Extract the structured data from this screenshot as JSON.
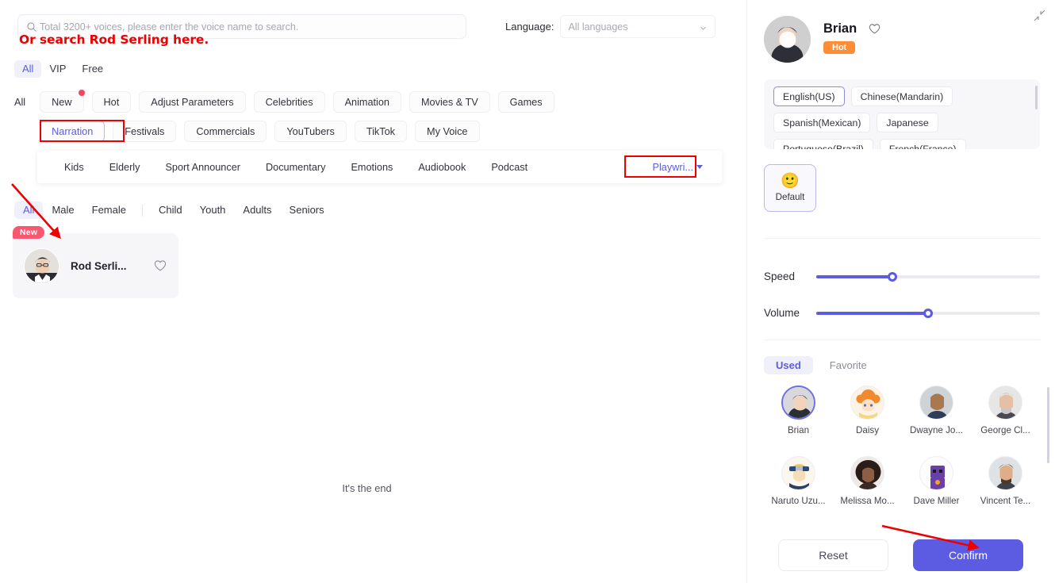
{
  "search": {
    "placeholder": "Total 3200+ voices, please enter the voice name to search.",
    "value": "",
    "icon": "search-icon"
  },
  "language_filter": {
    "label": "Language:",
    "selected": "All languages",
    "icon": "chevron-down-icon"
  },
  "annotation": {
    "search_hint": "Or search Rod Serling here.",
    "color": "#ee0000"
  },
  "tier_tabs": [
    {
      "label": "All",
      "active": true
    },
    {
      "label": "VIP",
      "active": false
    },
    {
      "label": "Free",
      "active": false
    }
  ],
  "category_row_1": {
    "all_label": "All",
    "chips": [
      {
        "label": "New",
        "badge_dot": true,
        "selected": false
      },
      {
        "label": "Hot",
        "badge_dot": false,
        "selected": false
      },
      {
        "label": "Adjust Parameters",
        "badge_dot": false,
        "selected": false
      },
      {
        "label": "Celebrities",
        "badge_dot": false,
        "selected": false
      },
      {
        "label": "Animation",
        "badge_dot": false,
        "selected": false
      },
      {
        "label": "Movies & TV",
        "badge_dot": false,
        "selected": false
      },
      {
        "label": "Games",
        "badge_dot": false,
        "selected": false
      }
    ]
  },
  "category_row_2": {
    "chips": [
      {
        "label": "Narration",
        "selected": true
      },
      {
        "label": "Festivals",
        "selected": false
      },
      {
        "label": "Commercials",
        "selected": false
      },
      {
        "label": "YouTubers",
        "selected": false
      },
      {
        "label": "TikTok",
        "selected": false
      },
      {
        "label": "My Voice",
        "selected": false
      }
    ]
  },
  "sub_categories": {
    "items": [
      {
        "label": "Kids"
      },
      {
        "label": "Elderly"
      },
      {
        "label": "Sport Announcer"
      },
      {
        "label": "Documentary"
      },
      {
        "label": "Emotions"
      },
      {
        "label": "Audiobook"
      },
      {
        "label": "Podcast"
      }
    ],
    "dropdown_label": "Playwri...",
    "dropdown_icon": "caret-down-icon"
  },
  "gender_filter": [
    {
      "label": "All",
      "active": true
    },
    {
      "label": "Male",
      "active": false
    },
    {
      "label": "Female",
      "active": false
    },
    {
      "divider": true
    },
    {
      "label": "Child",
      "active": false
    },
    {
      "label": "Youth",
      "active": false
    },
    {
      "label": "Adults",
      "active": false
    },
    {
      "label": "Seniors",
      "active": false
    }
  ],
  "voice_results": [
    {
      "name": "Rod Serli...",
      "badge": "New",
      "favorited": false
    }
  ],
  "list_end_text": "It's the end",
  "detail_panel": {
    "collapse_icon": "collapse-icon",
    "voice_name": "Brian",
    "hot_badge": "Hot",
    "favorite_icon": "heart-icon",
    "play_icon": "play-icon",
    "languages": [
      {
        "label": "English(US)",
        "selected": true
      },
      {
        "label": "Chinese(Mandarin)",
        "selected": false
      },
      {
        "label": "Spanish(Mexican)",
        "selected": false
      },
      {
        "label": "Japanese",
        "selected": false
      },
      {
        "label": "Portuguese(Brazil)",
        "selected": false
      },
      {
        "label": "French(France)",
        "selected": false
      }
    ],
    "emotion": {
      "label": "Default",
      "face": "🙂",
      "selected": true
    },
    "sliders": [
      {
        "label": "Speed",
        "percent": 34
      },
      {
        "label": "Volume",
        "percent": 50
      }
    ],
    "library_tabs": [
      {
        "label": "Used",
        "active": true
      },
      {
        "label": "Favorite",
        "active": false
      }
    ],
    "library_voices": [
      {
        "name": "Brian",
        "selected": true
      },
      {
        "name": "Daisy",
        "selected": false
      },
      {
        "name": "Dwayne Jo...",
        "selected": false
      },
      {
        "name": "George Cl...",
        "selected": false
      },
      {
        "name": "Naruto Uzu...",
        "selected": false
      },
      {
        "name": "Melissa Mo...",
        "selected": false
      },
      {
        "name": "Dave Miller",
        "selected": false
      },
      {
        "name": "Vincent Te...",
        "selected": false
      }
    ],
    "reset_button": "Reset",
    "confirm_button": "Confirm"
  },
  "colors": {
    "accent": "#5b5ce2",
    "hot_badge": "#fd8e36",
    "new_badge": "#f9566f",
    "annotation": "#ee0000"
  }
}
